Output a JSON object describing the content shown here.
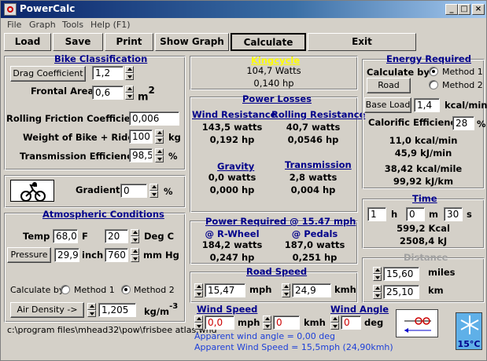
{
  "window": {
    "title": "PowerCalc"
  },
  "menu": [
    "File",
    "Graph",
    "Tools",
    "Help (F1)"
  ],
  "toolbar": {
    "load": "Load",
    "save": "Save",
    "print": "Print",
    "show_graph": "Show Graph",
    "calculate": "Calculate",
    "exit": "Exit"
  },
  "bike": {
    "header": "Bike Classification",
    "drag_button": "Drag Coefficient",
    "drag_value": "1,2",
    "frontal_label": "Frontal Area",
    "frontal_value": "0,6",
    "frontal_unit": "m",
    "frontal_sup": "2",
    "rolling_label": "Rolling Friction Coefficient",
    "rolling_value": "0,006",
    "weight_label": "Weight of Bike + Rider",
    "weight_value": "100",
    "weight_unit": "kg",
    "trans_label": "Transmission Efficiency",
    "trans_value": "98,5",
    "trans_unit": "%"
  },
  "gradient": {
    "label": "Gradient",
    "value": "0",
    "unit": "%"
  },
  "atmos": {
    "header": "Atmospheric Conditions",
    "temp_label": "Temp",
    "temp_f": "68,0",
    "temp_f_unit": "F",
    "temp_c": "20",
    "temp_c_unit": "Deg C",
    "pressure_button": "Pressure",
    "pressure_inch": "29,9",
    "pressure_inch_unit": "inch",
    "pressure_mm": "760",
    "pressure_mm_unit": "mm Hg",
    "calc_by": "Calculate by",
    "method1": "Method 1",
    "method2": "Method 2",
    "density_button": "Air Density ->",
    "density_value": "1,205",
    "density_unit": "kg/m",
    "density_sup": "-3"
  },
  "status_path": "c:\\program files\\mhead32\\pow\\frisbee atlas.wnd",
  "kingcycle": {
    "title": "Kingcycle",
    "watts": "104,7 Watts",
    "hp": "0,140 hp"
  },
  "losses": {
    "header": "Power Losses",
    "wind_hdr": "Wind Resistance",
    "wind_w": "143,5 watts",
    "wind_hp": "0,192 hp",
    "roll_hdr": "Rolling Resistance",
    "roll_w": "40,7 watts",
    "roll_hp": "0,0546 hp",
    "grav_hdr": "Gravity",
    "grav_w": "0,0 watts",
    "grav_hp": "0,000 hp",
    "trans_hdr": "Transmission",
    "trans_w": "2,8 watts",
    "trans_hp": "0,004 hp"
  },
  "required": {
    "header": "Power Required @  15.47 mph",
    "rwheel_hdr": "@ R-Wheel",
    "rwheel_w": "184,2 watts",
    "rwheel_hp": "0,247 hp",
    "pedals_hdr": "@ Pedals",
    "pedals_w": "187,0 watts",
    "pedals_hp": "0,251 hp"
  },
  "road": {
    "header": "Road Speed",
    "mph": "15,47",
    "mph_unit": "mph",
    "kmh": "24,9",
    "kmh_unit": "kmh"
  },
  "wind": {
    "speed_header": "Wind Speed",
    "mph": "0,0",
    "mph_unit": "mph",
    "kmh": "0",
    "kmh_unit": "kmh",
    "angle_header": "Wind Angle",
    "angle": "0",
    "angle_unit": "deg",
    "apparent_angle": "Apparent wind angle = 0,00 deg",
    "apparent_speed": "Apparent Wind Speed = 15,5mph (24,90kmh)"
  },
  "energy": {
    "header": "Energy Required",
    "calc_by": "Calculate by",
    "method1": "Method 1",
    "method2": "Method 2",
    "road_button": "Road",
    "base_button": "Base Load",
    "base_value": "1,4",
    "base_unit": "kcal/min",
    "eff_label": "Calorific Efficiency",
    "eff_value": "28",
    "eff_unit": "%",
    "kcal_min": "11,0 kcal/min",
    "kj_min": "45,9 kJ/min",
    "kcal_mile": "38,42 kcal/mile",
    "kj_km": "99,92 kJ/km"
  },
  "time": {
    "header": "Time",
    "h": "1",
    "h_unit": "h",
    "m": "0",
    "m_unit": "m",
    "s": "30",
    "s_unit": "s",
    "kcal": "599,2 Kcal",
    "kj": "2508,4 kJ"
  },
  "distance": {
    "header": "Distance",
    "miles": "15,60",
    "miles_unit": "miles",
    "km": "25,10",
    "km_unit": "km"
  },
  "temp_badge": "15°C",
  "colors": {
    "title_start": "#0a246a",
    "header_blue": "#00008b",
    "kingcycle_yellow": "#ffff00",
    "wind_red": "#cc0000",
    "face": "#d4d0c8"
  }
}
